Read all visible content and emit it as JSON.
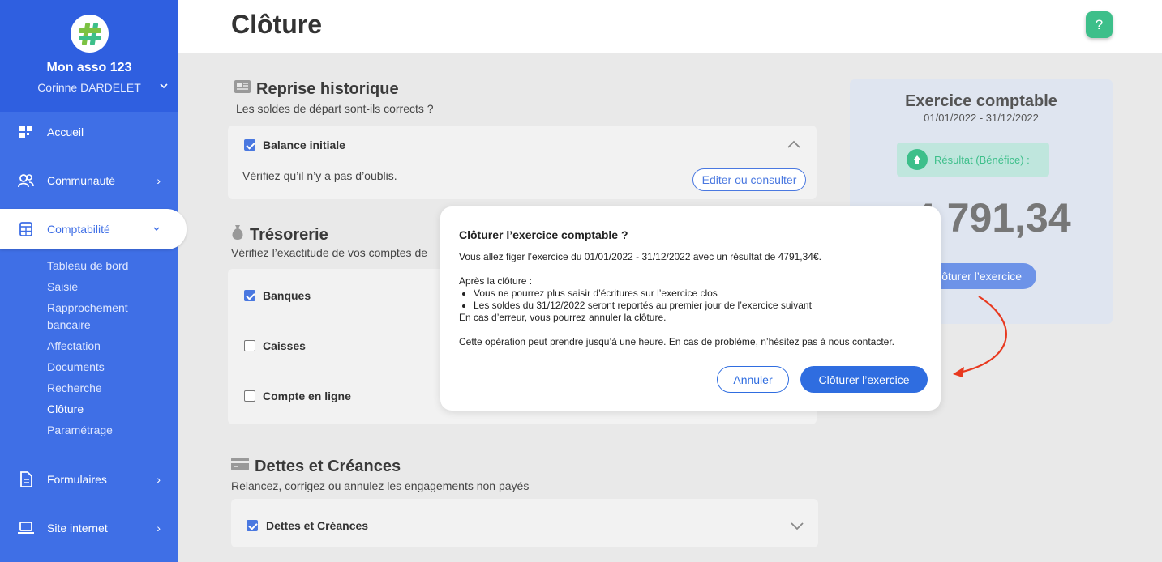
{
  "sidebar": {
    "org_name": "Mon asso 123",
    "user_name": "Corinne DARDELET",
    "nav": {
      "home": "Accueil",
      "community": "Communauté",
      "accounting": "Comptabilité",
      "forms": "Formulaires",
      "website": "Site internet"
    },
    "sub_items": [
      "Tableau de bord",
      "Saisie",
      "Rapprochement bancaire",
      "Affectation",
      "Documents",
      "Recherche",
      "Clôture",
      "Paramétrage"
    ]
  },
  "header": {
    "title": "Clôture",
    "help": "?"
  },
  "reprise": {
    "title": "Reprise historique",
    "subtitle": "Les soldes de départ sont-ils corrects ?",
    "item_label": "Balance initiale",
    "item_text": "Vérifiez qu’il n’y a pas d’oublis.",
    "button": "Editer ou consulter"
  },
  "tresorerie": {
    "title": "Trésorerie",
    "subtitle": "Vérifiez l’exactitude de vos comptes de",
    "items": [
      "Banques",
      "Caisses",
      "Compte en ligne"
    ]
  },
  "dettes": {
    "title": "Dettes et Créances",
    "subtitle": "Relancez, corrigez ou annulez les engagements non payés",
    "item_label": "Dettes et Créances"
  },
  "panel": {
    "title": "Exercice comptable",
    "dates": "01/01/2022 - 31/12/2022",
    "result_label": "Résultat (Bénéfice) :",
    "amount": "4 791,34",
    "button": "Clôturer l’exercice"
  },
  "modal": {
    "title": "Clôturer l’exercice comptable ?",
    "line1": "Vous allez figer l’exercice du 01/01/2022 - 31/12/2022 avec un résultat de 4791,34€.",
    "after_label": "Après la clôture :",
    "bullet1": "Vous ne pourrez plus saisir d’écritures sur l’exercice clos",
    "bullet2": "Les soldes du 31/12/2022 seront reportés au premier jour de l’exercice suivant",
    "error_line": "En cas d’erreur, vous pourrez annuler la clôture.",
    "duration_line": "Cette opération peut prendre jusqu’à une heure. En cas de problème, n’hésitez pas à nous contacter.",
    "cancel": "Annuler",
    "confirm": "Clôturer l’exercice"
  },
  "colors": {
    "primary": "#3f6fe6",
    "accent": "#3dbf8a",
    "arrow": "#e8391f"
  }
}
